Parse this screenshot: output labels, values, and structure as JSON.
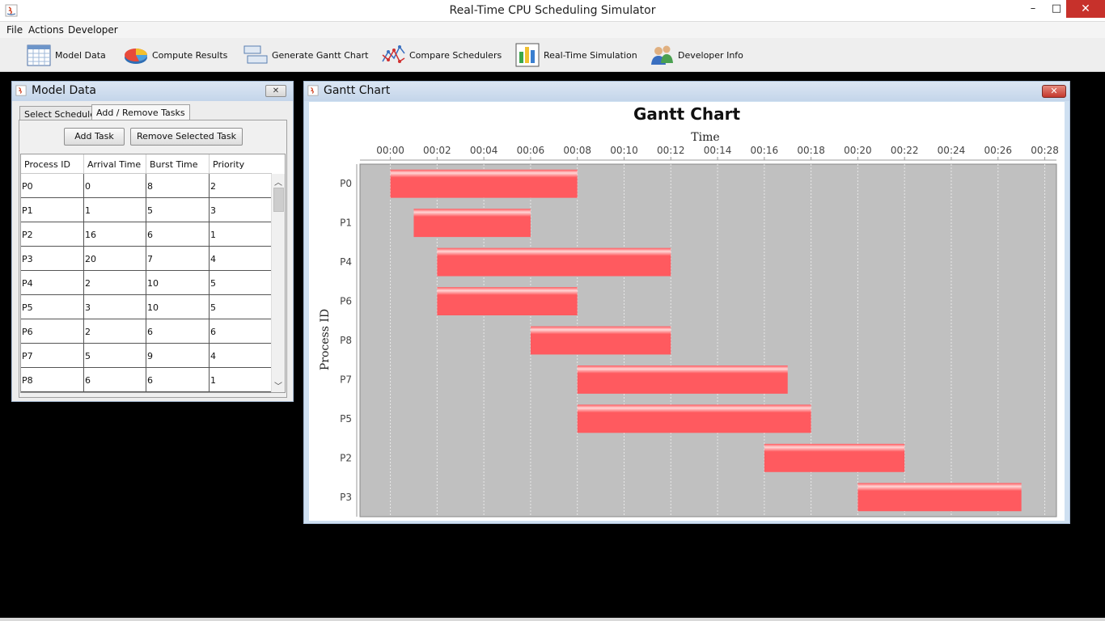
{
  "window": {
    "title": "Real-Time CPU Scheduling Simulator",
    "min": "–",
    "max": "□",
    "close": "✕"
  },
  "menu": {
    "file": "File",
    "actions": "Actions",
    "developer": "Developer"
  },
  "toolbar": {
    "model_data": "Model Data",
    "compute_results": "Compute Results",
    "generate_gantt": "Generate Gantt Chart",
    "compare": "Compare Schedulers",
    "realtime": "Real-Time Simulation",
    "developer_info": "Developer Info"
  },
  "model_frame": {
    "title": "Model Data",
    "close": "✕",
    "tabs": {
      "select": "Select Scheduler",
      "addremove": "Add / Remove Tasks"
    },
    "add_task": "Add Task",
    "remove_task": "Remove Selected Task",
    "columns": [
      "Process ID",
      "Arrival Time",
      "Burst Time",
      "Priority"
    ],
    "rows": [
      [
        "P0",
        "0",
        "8",
        "2"
      ],
      [
        "P1",
        "1",
        "5",
        "3"
      ],
      [
        "P2",
        "16",
        "6",
        "1"
      ],
      [
        "P3",
        "20",
        "7",
        "4"
      ],
      [
        "P4",
        "2",
        "10",
        "5"
      ],
      [
        "P5",
        "3",
        "10",
        "5"
      ],
      [
        "P6",
        "2",
        "6",
        "6"
      ],
      [
        "P7",
        "5",
        "9",
        "4"
      ],
      [
        "P8",
        "6",
        "6",
        "1"
      ]
    ]
  },
  "gantt_frame": {
    "title": "Gantt Chart",
    "close": "✕"
  },
  "chart_data": {
    "type": "bar",
    "title": "Gantt Chart",
    "xlabel": "Time",
    "ylabel": "Process ID",
    "xlim": [
      -1.3,
      28.5
    ],
    "x_ticks": [
      "00:00",
      "00:02",
      "00:04",
      "00:06",
      "00:08",
      "00:10",
      "00:12",
      "00:14",
      "00:16",
      "00:18",
      "00:20",
      "00:22",
      "00:24",
      "00:26",
      "00:28"
    ],
    "categories": [
      "P0",
      "P1",
      "P4",
      "P6",
      "P8",
      "P7",
      "P5",
      "P2",
      "P3"
    ],
    "tasks": [
      {
        "name": "P0",
        "start": 0,
        "end": 8
      },
      {
        "name": "P1",
        "start": 1,
        "end": 6
      },
      {
        "name": "P4",
        "start": 2,
        "end": 12
      },
      {
        "name": "P6",
        "start": 2,
        "end": 8
      },
      {
        "name": "P8",
        "start": 6,
        "end": 12
      },
      {
        "name": "P7",
        "start": 8,
        "end": 17
      },
      {
        "name": "P5",
        "start": 8,
        "end": 18
      },
      {
        "name": "P2",
        "start": 16,
        "end": 22
      },
      {
        "name": "P3",
        "start": 20,
        "end": 27
      }
    ],
    "grid": true,
    "colors": {
      "bar": "#ff5a5f",
      "bar_highlight": "#ffd6d6",
      "plot_bg": "#c0c0c0",
      "grid": "#e8e8e8"
    }
  }
}
